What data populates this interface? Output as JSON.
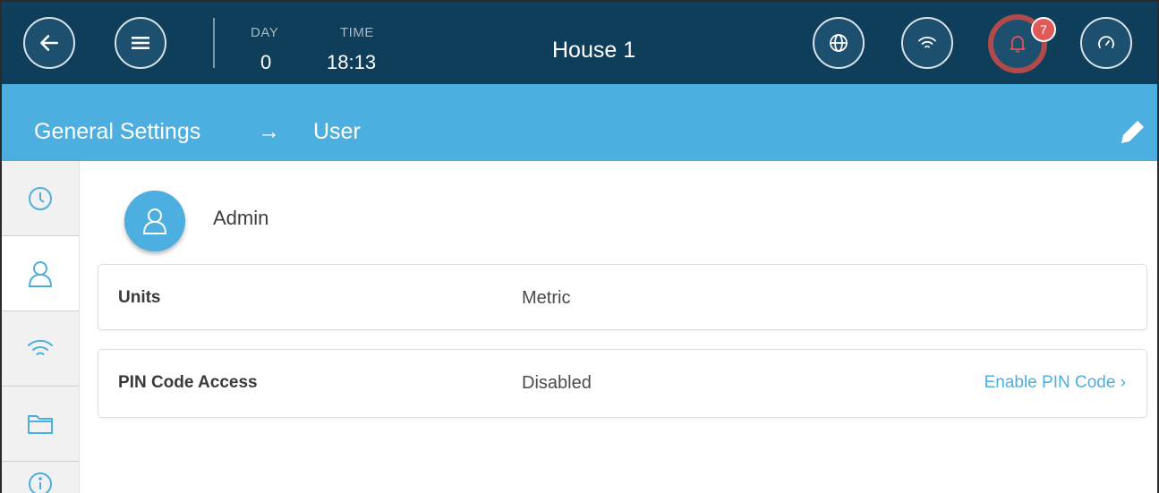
{
  "header": {
    "day_label": "DAY",
    "day_value": "0",
    "time_label": "TIME",
    "time_value": "18:13",
    "house_title": "House 1",
    "alarm_count": "7",
    "icons": {
      "back": "arrow-left-icon",
      "menu": "hamburger-menu-icon",
      "globe": "globe-icon",
      "wifi": "wifi-icon",
      "bell": "bell-icon",
      "gauge": "gauge-icon"
    },
    "colors": {
      "bar": "#0f3e5a",
      "alarm_ring": "#b14a4a",
      "badge": "#e15a5a"
    }
  },
  "breadcrumb": {
    "parent": "General Settings",
    "separator": "→",
    "current": "User",
    "edit_icon": "pencil-icon",
    "color": "#4daee0"
  },
  "sidebar": {
    "items": [
      {
        "icon": "clock-icon",
        "active": false
      },
      {
        "icon": "user-icon",
        "active": true
      },
      {
        "icon": "wifi-icon",
        "active": false
      },
      {
        "icon": "folder-icon",
        "active": false
      },
      {
        "icon": "info-icon",
        "active": false
      }
    ]
  },
  "user": {
    "name": "Admin",
    "icon": "user-icon"
  },
  "settings": {
    "units": {
      "label": "Units",
      "value": "Metric"
    },
    "pin": {
      "label": "PIN Code Access",
      "value": "Disabled",
      "action": "Enable PIN Code ›"
    }
  }
}
